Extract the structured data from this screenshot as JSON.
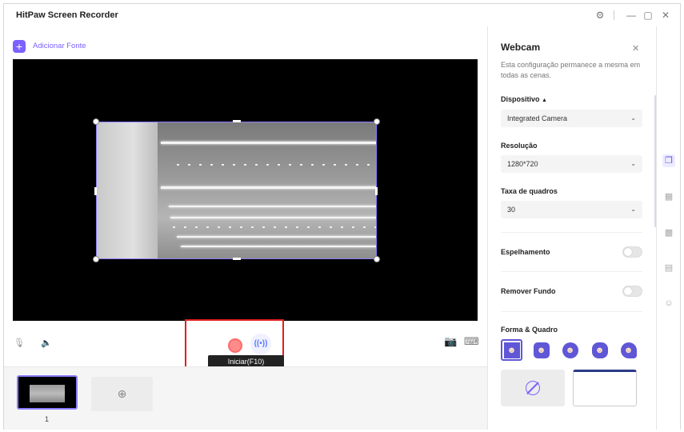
{
  "app": {
    "title": "HitPaw Screen Recorder"
  },
  "toolbar": {
    "add_source_label": "Adicionar Fonte"
  },
  "record": {
    "tooltip": "Iniciar(F10)"
  },
  "scenes": [
    {
      "number": "1"
    }
  ],
  "webcam_panel": {
    "title": "Webcam",
    "description": "Esta configuração permanece a mesma em todas as cenas.",
    "device_label": "Dispositivo",
    "device_value": "Integrated Camera",
    "resolution_label": "Resolução",
    "resolution_value": "1280*720",
    "framerate_label": "Taxa de quadros",
    "framerate_value": "30",
    "mirror_label": "Espelhamento",
    "remove_bg_label": "Remover Fundo",
    "shape_label": "Forma & Quadro",
    "mirror_on": false,
    "remove_bg_on": false
  },
  "colors": {
    "accent": "#7b61ff",
    "highlight": "#e02020"
  },
  "icons": {
    "window": [
      "settings-icon",
      "minimize-icon",
      "maximize-icon",
      "close-icon"
    ],
    "strip": [
      "layers-icon",
      "layout-icon",
      "texture-icon",
      "text-icon",
      "sticker-icon"
    ]
  }
}
